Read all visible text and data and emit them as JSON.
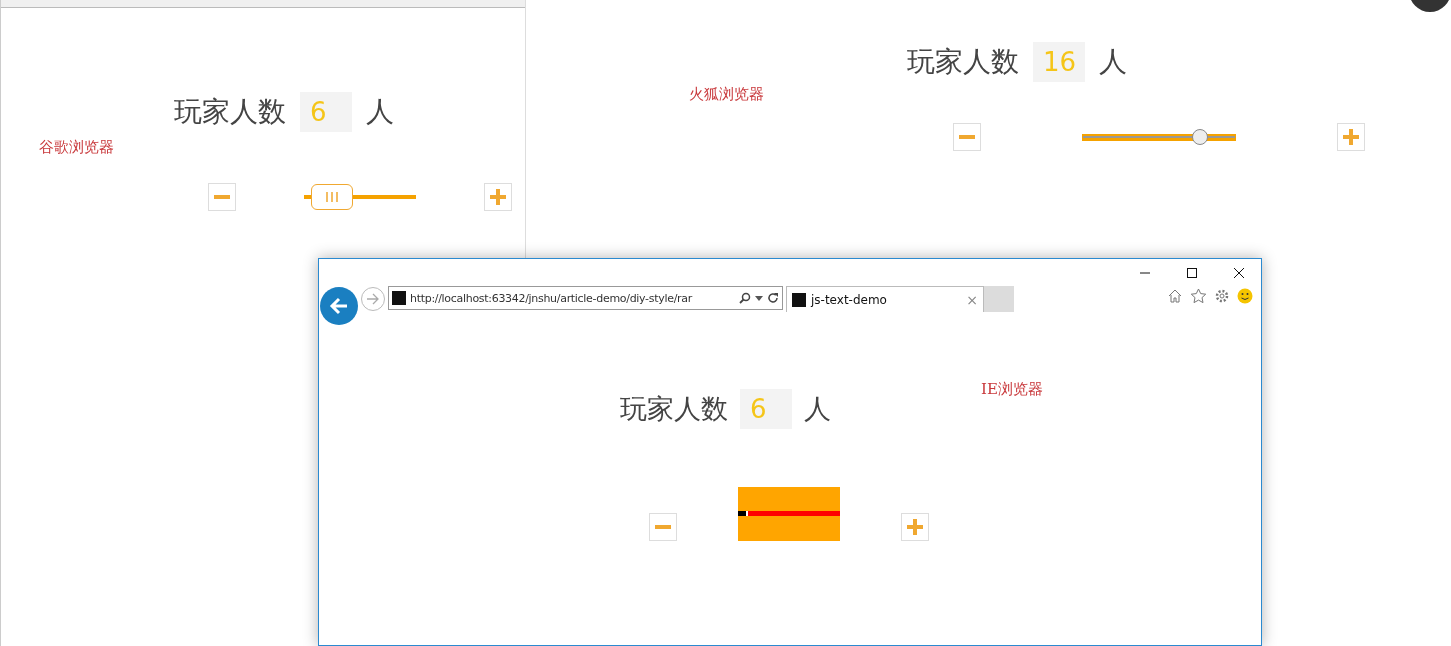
{
  "windows": [
    {
      "kind": "chrome",
      "browser_label": "谷歌浏览器",
      "title": "玩家人数",
      "value": "6",
      "unit": "人",
      "slider": {
        "level": 0.1
      }
    },
    {
      "kind": "firefox",
      "browser_label": "火狐浏览器",
      "title": "玩家人数",
      "value": "16",
      "unit": "人",
      "slider": {
        "level": 0.8
      }
    },
    {
      "kind": "ie",
      "browser_label": "IE浏览器",
      "title": "玩家人数",
      "value": "6",
      "unit": "人",
      "slider": {
        "level": 0.1
      },
      "address": "http://localhost:63342/jnshu/article-demo/diy-style/rar",
      "tab": {
        "title": "js-text-demo",
        "close": "×"
      }
    }
  ]
}
